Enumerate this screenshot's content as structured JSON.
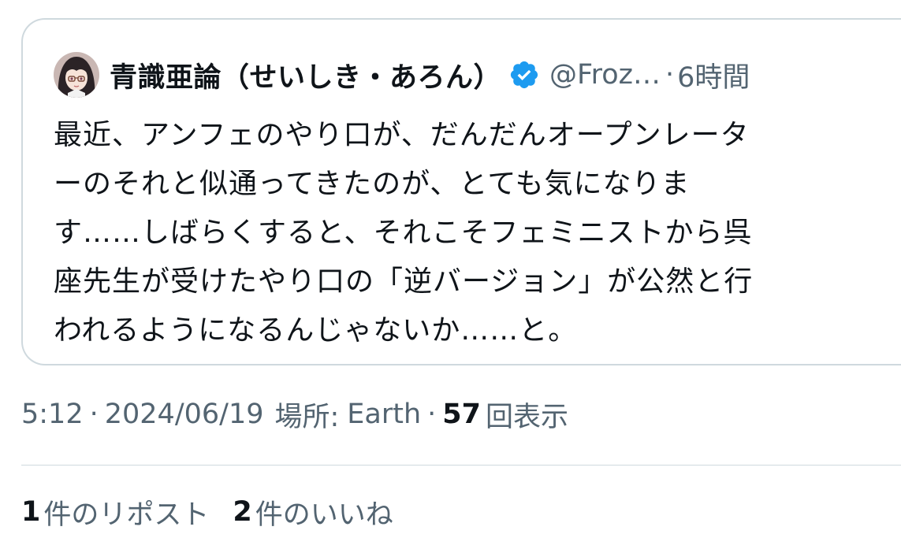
{
  "quoted_tweet": {
    "author": {
      "display_name": "青識亜論（せいしき・あろん）",
      "handle": "@Froz…",
      "avatar_icon": "anime-girl-avatar-icon",
      "verified_icon": "verified-badge-icon",
      "verified_color": "#1d9bf0"
    },
    "separator": "·",
    "time_ago": "6時間",
    "body_lines": [
      "最近、アンフェのやり口が、だんだんオープンレータ",
      "ーのそれと似通ってきたのが、とても気になりま",
      "す……しばらくすると、それこそフェミニストから呉",
      "座先生が受けたやり口の「逆バージョン」が公然と行",
      "われるようになるんじゃないか……と。"
    ]
  },
  "meta": {
    "time": "5:12",
    "separator": "·",
    "date": "2024/06/19",
    "location_label": "場所:",
    "location_value": "Earth",
    "views_count": "57",
    "views_label": "回表示"
  },
  "stats": {
    "reposts_count": "1",
    "reposts_label": "件のリポスト",
    "likes_count": "2",
    "likes_label": "件のいいね"
  },
  "colors": {
    "text_primary": "#0f1419",
    "text_secondary": "#536471",
    "border": "#cfd9de",
    "accent": "#1d9bf0"
  }
}
